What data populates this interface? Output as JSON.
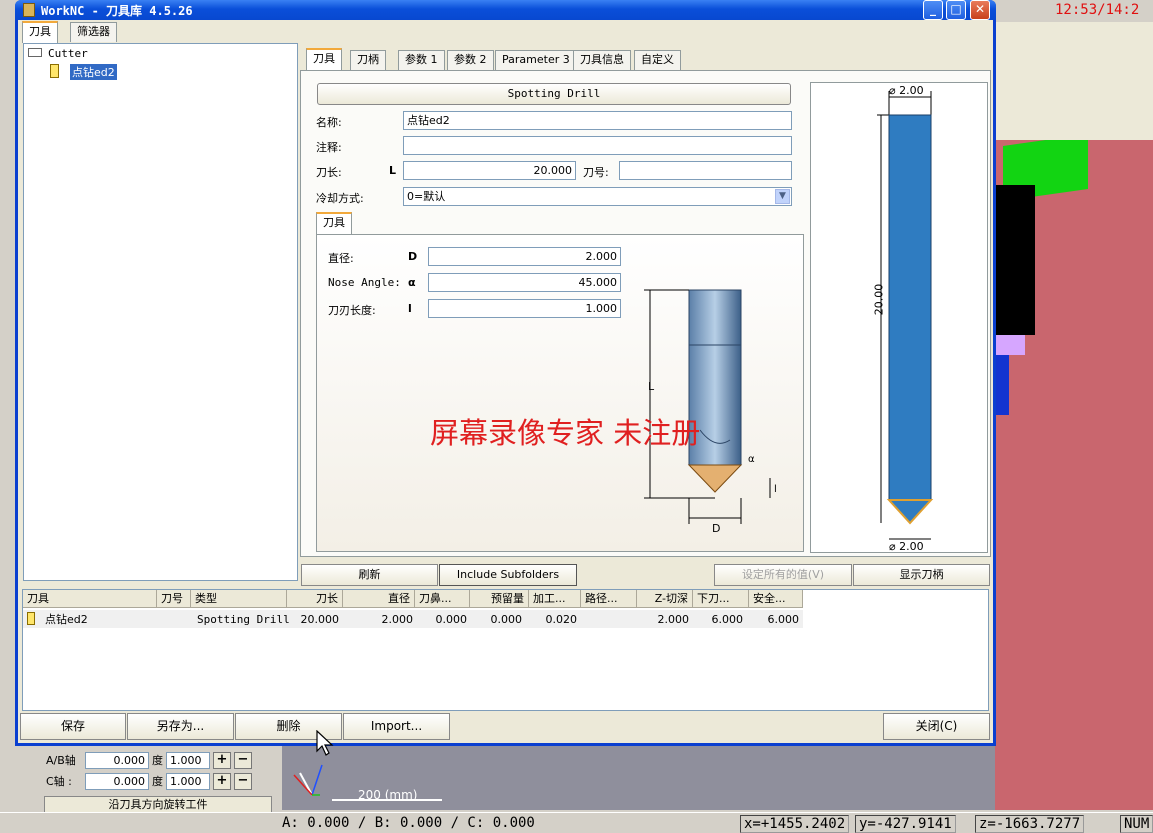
{
  "background": {
    "clock": "12:53/14:2",
    "left_panel": {
      "ab_axis_label": "A/B轴",
      "ab_axis_value": "0.000",
      "ab_unit": "度",
      "ab_step": "1.000",
      "c_axis_label": "C轴 :",
      "c_axis_value": "0.000",
      "c_unit": "度",
      "c_step": "1.000",
      "plus": "+",
      "minus": "−",
      "rotate_button": "沿刀具方向旋转工件"
    },
    "scale": "200 (mm)",
    "status": {
      "abc": "A:  0.000 / B:  0.000 / C:  0.000",
      "x": "x=+1455.2402",
      "y": "y=-427.9141",
      "z": "z=-1663.7277",
      "num": "NUM"
    }
  },
  "window": {
    "title": "WorkNC - 刀具库 4.5.26",
    "minimize": "_",
    "maximize": "□",
    "close": "✕"
  },
  "left_tabs": [
    "刀具",
    "筛选器"
  ],
  "tree": {
    "root": "Cutter",
    "child": "点钻ed2"
  },
  "tabs": [
    "刀具",
    "刀柄",
    "参数 1",
    "参数 2",
    "Parameter 3",
    "刀具信息",
    "自定义"
  ],
  "form": {
    "type_button": "Spotting Drill",
    "name_label": "名称:",
    "name_value": "点钻ed2",
    "comment_label": "注释:",
    "comment_value": "",
    "length_label": "刀长:",
    "length_symbol": "L",
    "length_value": "20.000",
    "toolno_label": "刀号:",
    "toolno_value": "",
    "coolant_label": "冷却方式:",
    "coolant_value": "0=默认"
  },
  "section": {
    "tab": "刀具",
    "diameter_label": "直径:",
    "diameter_symbol": "D",
    "diameter_value": "2.000",
    "nose_label": "Nose Angle:",
    "nose_symbol": "α",
    "nose_value": "45.000",
    "edge_label": "刀刃长度:",
    "edge_symbol": "l",
    "edge_value": "1.000",
    "drawing_L": "L",
    "drawing_alpha": "α",
    "drawing_l": "l",
    "drawing_D": "D"
  },
  "preview": {
    "top_dim": "⌀ 2.00",
    "length_dim": "20.00",
    "bottom_dim": "⌀ 2.00"
  },
  "toolbar": {
    "refresh": "刷新",
    "include_subfolders": "Include Subfolders",
    "set_all_values": "设定所有的值(V)",
    "show_holder": "显示刀柄"
  },
  "table": {
    "headers": [
      "刀具",
      "刀号",
      "类型",
      "刀长",
      "直径",
      "刀鼻...",
      "预留量",
      "加工...",
      "路径...",
      "Z-切深",
      "下刀...",
      "安全..."
    ],
    "row": {
      "name": "点钻ed2",
      "number": "",
      "type": "Spotting Drill",
      "length": "20.000",
      "diameter": "2.000",
      "nose": "0.000",
      "allowance": "0.000",
      "machining": "0.020",
      "path": "",
      "zdepth": "2.000",
      "plunge": "6.000",
      "safety": "6.000"
    }
  },
  "bottom_buttons": {
    "save": "保存",
    "save_as": "另存为...",
    "delete": "删除",
    "import": "Import...",
    "close": "关闭(C)"
  },
  "watermark": "屏幕录像专家  未注册",
  "colors": {
    "titlebar": "#0a4fd9",
    "tool_blue": "#2f7cc1",
    "scene_red": "#c9666e",
    "watermark": "#e02020"
  }
}
